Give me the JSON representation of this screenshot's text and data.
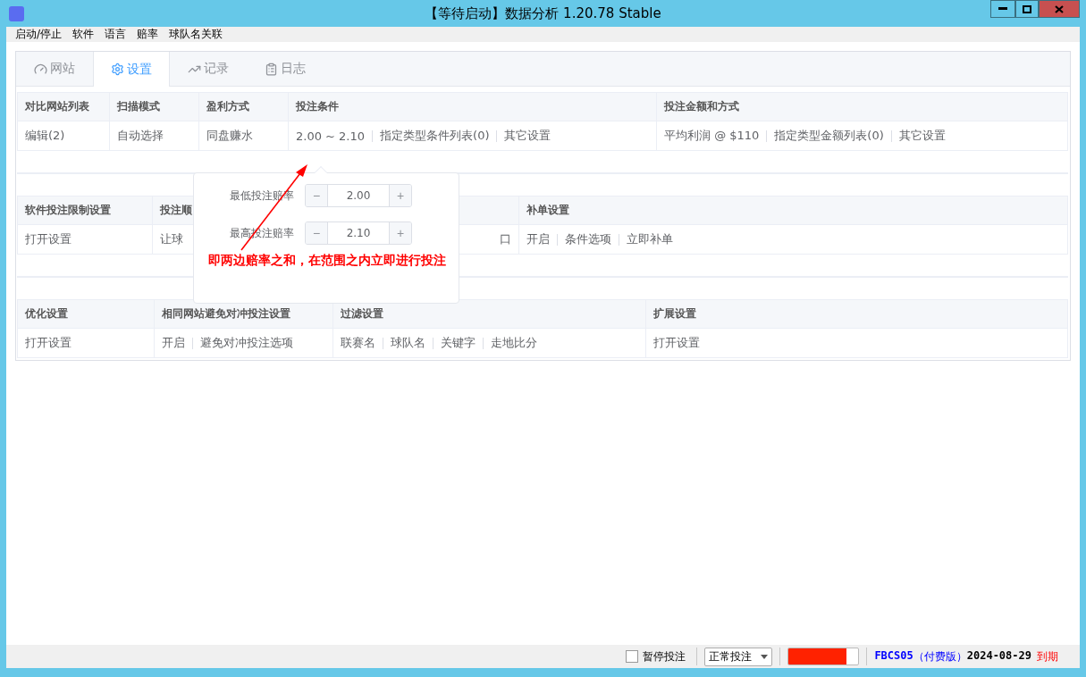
{
  "window": {
    "title": "【等待启动】数据分析 1.20.78 Stable"
  },
  "menu": [
    "启动/停止",
    "软件",
    "语言",
    "赔率",
    "球队名关联"
  ],
  "tabs": [
    {
      "label": "网站",
      "selected": false
    },
    {
      "label": "设置",
      "selected": true
    },
    {
      "label": "记录",
      "selected": false
    },
    {
      "label": "日志",
      "selected": false
    }
  ],
  "sections": [
    {
      "columns": [
        {
          "header": "对比网站列表",
          "items": [
            "编辑(2)"
          ]
        },
        {
          "header": "扫描模式",
          "items": [
            "自动选择"
          ]
        },
        {
          "header": "盈利方式",
          "items": [
            "同盘赚水"
          ]
        },
        {
          "header": "投注条件",
          "items": [
            "2.00 ~ 2.10",
            "指定类型条件列表(0)",
            "其它设置"
          ]
        },
        {
          "header": "投注金额和方式",
          "items": [
            "平均利润 @ $110",
            "指定类型金额列表(0)",
            "其它设置"
          ]
        }
      ]
    },
    {
      "columns": [
        {
          "header": "软件投注限制设置",
          "items": [
            "打开设置"
          ]
        },
        {
          "header": "投注顺",
          "items": [
            "让球"
          ]
        },
        {
          "items": [
            "口"
          ]
        },
        {
          "header": "补单设置",
          "items": [
            "开启",
            "条件选项",
            "立即补单"
          ]
        }
      ]
    },
    {
      "columns": [
        {
          "header": "优化设置",
          "items": [
            "打开设置"
          ]
        },
        {
          "header": "相同网站避免对冲投注设置",
          "items": [
            "开启",
            "避免对冲投注选项"
          ]
        },
        {
          "header": "过滤设置",
          "items": [
            "联赛名",
            "球队名",
            "关键字",
            "走地比分"
          ]
        },
        {
          "header": "扩展设置",
          "items": [
            "打开设置"
          ]
        }
      ]
    }
  ],
  "popover": {
    "fields": [
      {
        "label": "最低投注赔率",
        "value": "2.00",
        "minus": "−",
        "plus": "+"
      },
      {
        "label": "最高投注赔率",
        "value": "2.10",
        "minus": "−",
        "plus": "+"
      }
    ],
    "annotation": "即两边赔率之和，在范围之内立即进行投注"
  },
  "status_bar": {
    "pause": {
      "label": "暂停投注",
      "checked": false
    },
    "mode": "正常投注",
    "progress": {
      "level": 0.83
    },
    "license": {
      "code": "FBCS05",
      "edition": "（付费版）",
      "date": "2024-08-29",
      "status": "到期"
    }
  }
}
